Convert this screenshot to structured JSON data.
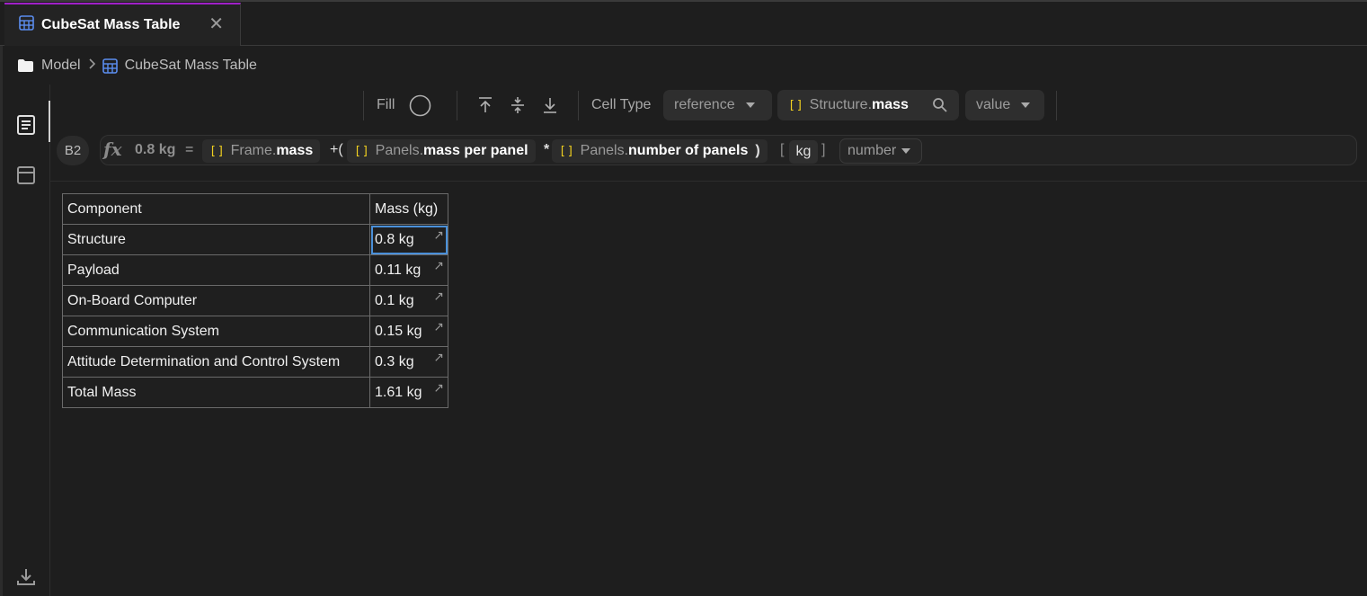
{
  "tab": {
    "title": "CubeSat Mass Table",
    "close_glyph": "✕"
  },
  "breadcrumb": {
    "root": "Model",
    "current": "CubeSat Mass Table"
  },
  "toolbar": {
    "fill_label": "Fill",
    "cell_type_label": "Cell Type",
    "cell_type_value": "reference",
    "reference_path": "Structure.",
    "reference_prop": "mass",
    "value_select": "value"
  },
  "formula": {
    "cell": "B2",
    "result": "0.8 kg",
    "equals": "=",
    "ref1_path": "Frame.",
    "ref1_prop": "mass",
    "plus_open": "+(",
    "ref2_path": "Panels.",
    "ref2_prop": "mass per panel",
    "times": "*",
    "ref3_path": "Panels.",
    "ref3_prop": "number of panels",
    "close_paren": ")",
    "unit_open": "[",
    "unit": "kg",
    "unit_close": "]",
    "type": "number"
  },
  "table": {
    "headers": [
      "Component",
      "Mass (kg)"
    ],
    "rows": [
      [
        "Structure",
        "0.8 kg"
      ],
      [
        "Payload",
        "0.11 kg"
      ],
      [
        "On-Board Computer",
        "0.1 kg"
      ],
      [
        "Communication System",
        "0.15 kg"
      ],
      [
        "Attitude Determination and Control System",
        "0.3 kg"
      ],
      [
        "Total Mass",
        "1.61 kg"
      ]
    ]
  },
  "colors": {
    "accent_tab": "#a020c8",
    "selection": "#4a90d9",
    "reference_bracket": "#f0d020"
  },
  "icons": [
    "table-icon",
    "folder-icon",
    "document-icon",
    "panel-icon",
    "download-icon",
    "search-icon"
  ]
}
